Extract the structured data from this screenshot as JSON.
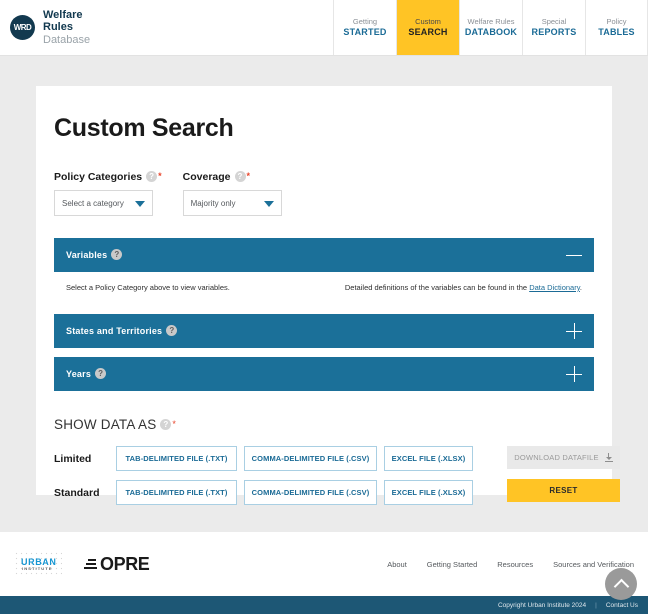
{
  "brand": {
    "mark_text": "WRD",
    "line1": "Welfare",
    "line2": "Rules",
    "line3": "Database"
  },
  "nav": {
    "items": [
      {
        "top": "Getting",
        "bottom": "STARTED",
        "active": false
      },
      {
        "top": "Custom",
        "bottom": "SEARCH",
        "active": true
      },
      {
        "top": "Welfare Rules",
        "bottom": "DATABOOK",
        "active": false
      },
      {
        "top": "Special",
        "bottom": "REPORTS",
        "active": false
      },
      {
        "top": "Policy",
        "bottom": "TABLES",
        "active": false
      }
    ]
  },
  "page": {
    "title": "Custom Search",
    "help_glyph": "?",
    "required_glyph": "*"
  },
  "filters": {
    "policy_categories": {
      "label": "Policy Categories",
      "value": "Select a category"
    },
    "coverage": {
      "label": "Coverage",
      "value": "Majority only"
    }
  },
  "accordions": [
    {
      "title": "Variables",
      "state": "expanded",
      "toggle": "minus"
    },
    {
      "title": "States and Territories",
      "state": "collapsed",
      "toggle": "plus"
    },
    {
      "title": "Years",
      "state": "collapsed",
      "toggle": "plus"
    }
  ],
  "variables_body": {
    "left_text": "Select a Policy Category above to view variables.",
    "right_text_before": "Detailed definitions of the variables can be found in the ",
    "right_link": "Data Dictionary",
    "right_text_after": "."
  },
  "show_data_as": {
    "title": "SHOW DATA AS",
    "rows": [
      {
        "label": "Limited",
        "buttons": [
          "TAB-DELIMITED FILE (.TXT)",
          "COMMA-DELIMITED FILE (.CSV)",
          "EXCEL FILE (.XLSX)"
        ]
      },
      {
        "label": "Standard",
        "buttons": [
          "TAB-DELIMITED FILE (.TXT)",
          "COMMA-DELIMITED FILE (.CSV)",
          "EXCEL FILE (.XLSX)"
        ]
      }
    ]
  },
  "actions": {
    "download_label": "DOWNLOAD DATAFILE",
    "download_disabled": true,
    "reset_label": "RESET"
  },
  "footer": {
    "urban_logo": {
      "top": "URBAN",
      "bottom": "INSTITUTE"
    },
    "opre_logo": "OPRE",
    "links": [
      "About",
      "Getting Started",
      "Resources",
      "Sources and Verification"
    ],
    "copyright": "Copyright Urban Institute 2024",
    "separator": "|",
    "contact": "Contact Us"
  },
  "colors": {
    "accent_blue": "#1b7099",
    "link_blue": "#1b6b96",
    "brand_yellow": "#ffc425",
    "navy": "#12394f",
    "footer_bar": "#1d5775",
    "page_bg": "#ebebeb",
    "required_red": "#e8452c"
  }
}
